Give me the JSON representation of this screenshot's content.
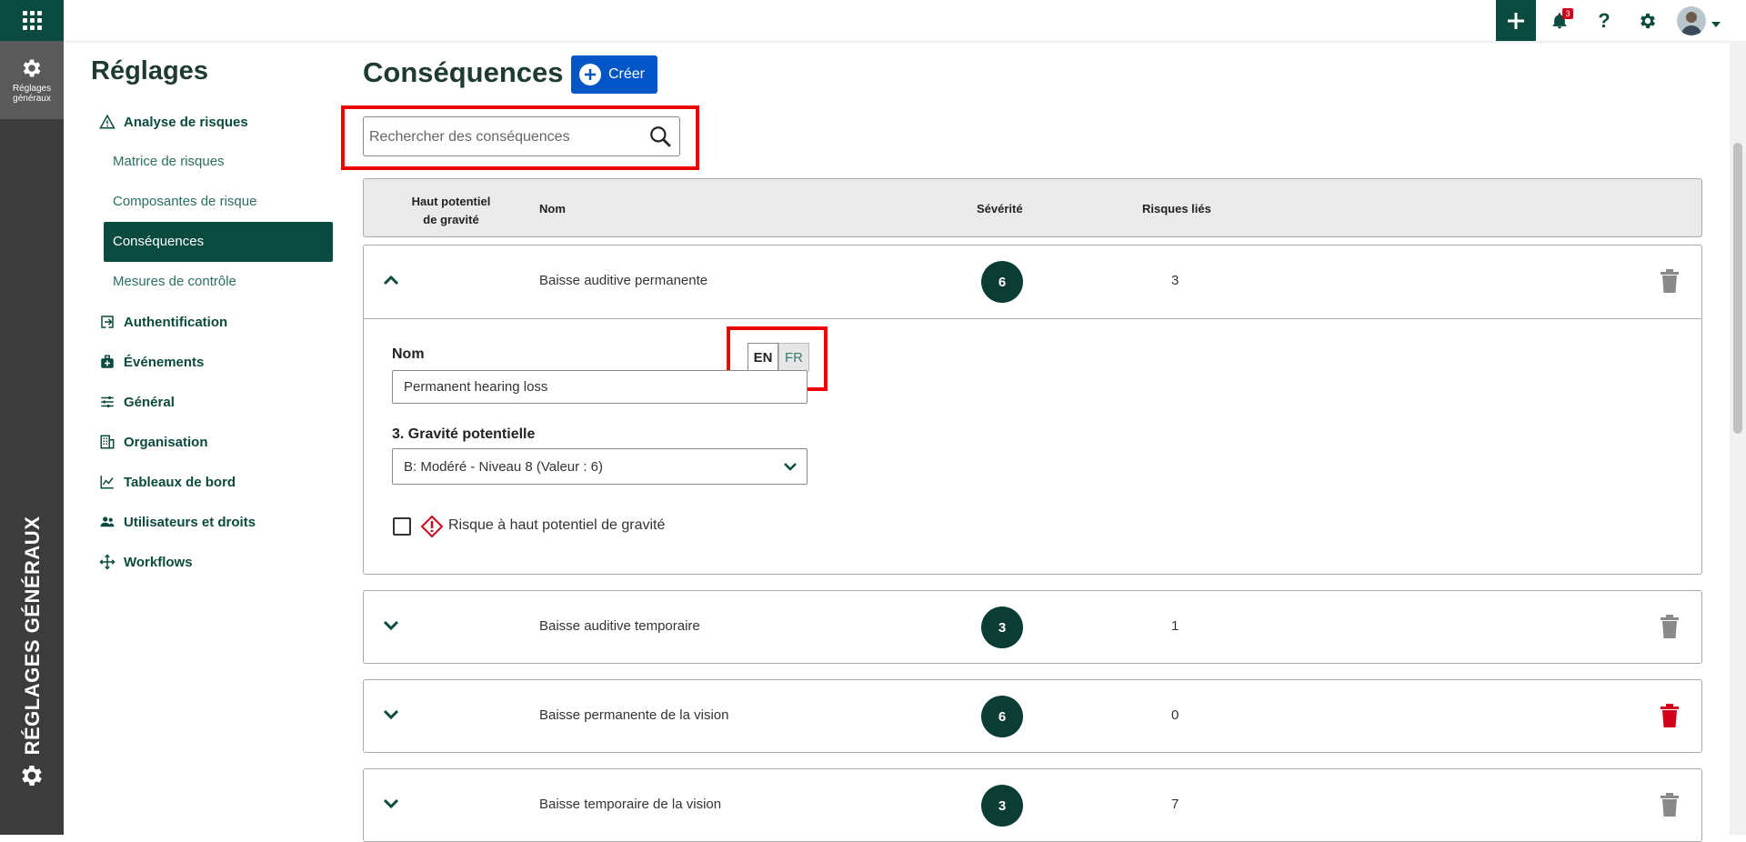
{
  "rail": {
    "active_label_line1": "Réglages",
    "active_label_line2": "généraux",
    "vertical_title": "RÉGLAGES GÉNÉRAUX"
  },
  "topbar": {
    "notifications_count": "3",
    "help_glyph": "?",
    "icons": [
      "apps-grid-icon",
      "plus-icon",
      "bell-icon",
      "help-icon",
      "gear-icon",
      "avatar",
      "caret-down-icon"
    ]
  },
  "sidebar": {
    "title": "Réglages",
    "sections": [
      {
        "label": "Analyse de risques",
        "icon": "warning-triangle-icon"
      },
      {
        "label": "Authentification",
        "icon": "login-icon"
      },
      {
        "label": "Événements",
        "icon": "medical-kit-icon"
      },
      {
        "label": "Général",
        "icon": "sliders-icon"
      },
      {
        "label": "Organisation",
        "icon": "building-icon"
      },
      {
        "label": "Tableaux de bord",
        "icon": "line-chart-icon"
      },
      {
        "label": "Utilisateurs et droits",
        "icon": "users-icon"
      },
      {
        "label": "Workflows",
        "icon": "workflow-icon"
      }
    ],
    "sub_items": [
      "Matrice de risques",
      "Composantes de risque",
      "Conséquences",
      "Mesures de contrôle"
    ],
    "selected": "Conséquences"
  },
  "main": {
    "title": "Conséquences",
    "create_label": "Créer",
    "search_placeholder": "Rechercher des conséquences",
    "columns": {
      "high_potential_line1": "Haut potentiel",
      "high_potential_line2": "de gravité",
      "name": "Nom",
      "severity": "Sévérité",
      "linked_risks": "Risques liés"
    },
    "rows": [
      {
        "name": "Baisse auditive permanente",
        "severity": "6",
        "risks": "3",
        "expanded": true,
        "trash_color": "#8a8a8a"
      },
      {
        "name": "Baisse auditive temporaire",
        "severity": "3",
        "risks": "1",
        "expanded": false,
        "trash_color": "#8a8a8a"
      },
      {
        "name": "Baisse permanente de la vision",
        "severity": "6",
        "risks": "0",
        "expanded": false,
        "trash_color": "#d0021b"
      },
      {
        "name": "Baisse temporaire de la vision",
        "severity": "3",
        "risks": "7",
        "expanded": false,
        "trash_color": "#8a8a8a"
      }
    ],
    "detail": {
      "name_label": "Nom",
      "lang_en": "EN",
      "lang_fr": "FR",
      "name_value": "Permanent hearing loss",
      "gravity_label": "3. Gravité potentielle",
      "gravity_value": "B: Modéré - Niveau 8 (Valeur : 6)",
      "checkbox_label": "Risque à haut potentiel de gravité"
    }
  },
  "colors": {
    "brand_dark": "#0b4a3e",
    "create_blue": "#0056c7",
    "highlight_red": "#e00000"
  }
}
